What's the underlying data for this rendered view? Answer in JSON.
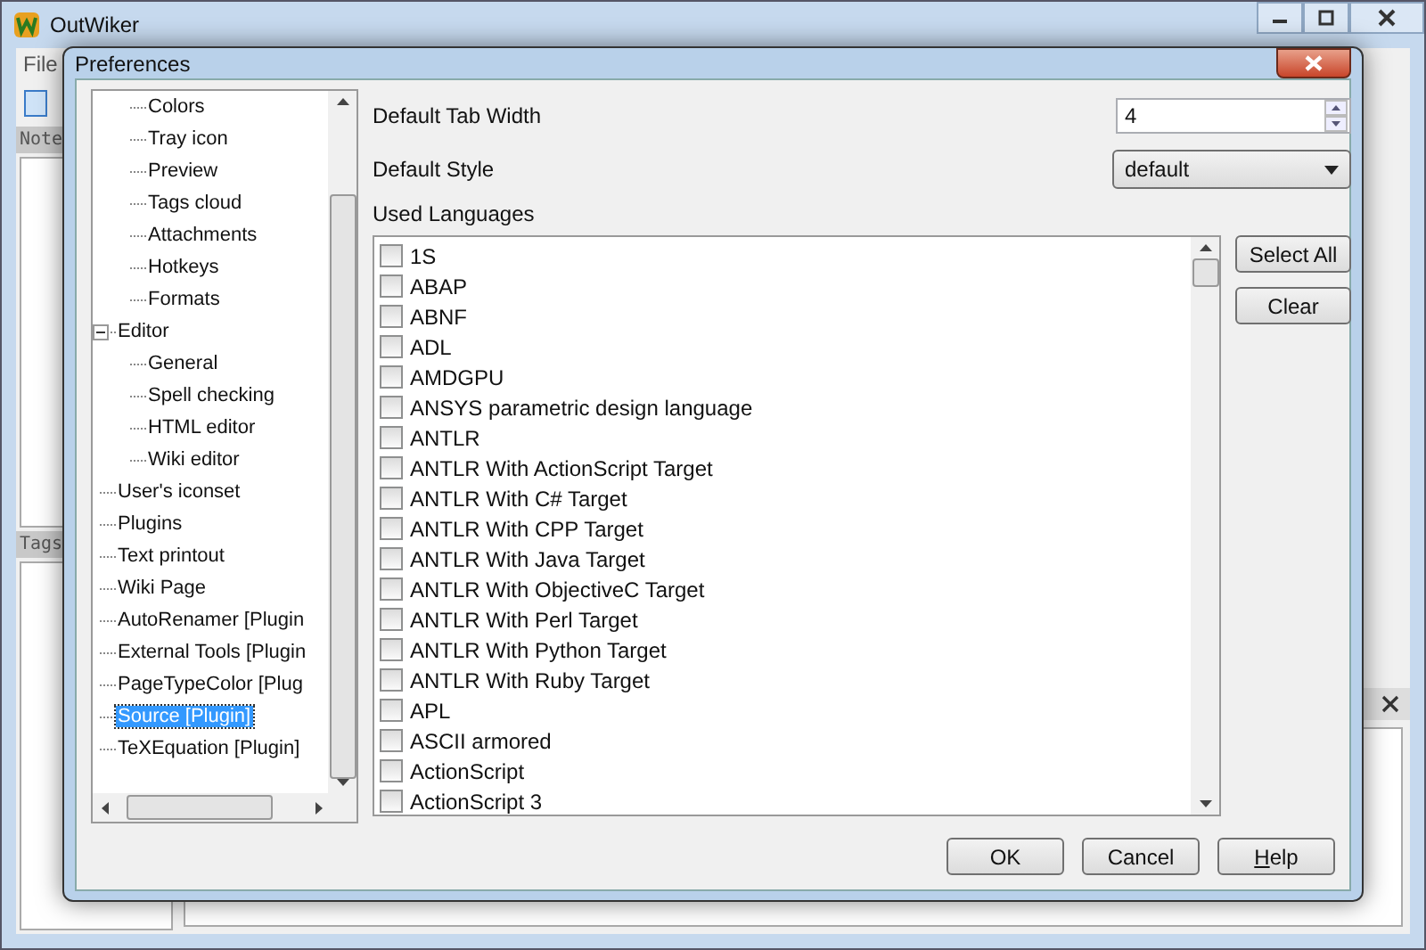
{
  "main_window": {
    "title": "OutWiker",
    "menu": [
      "File"
    ],
    "panels": [
      {
        "label": "Note"
      },
      {
        "label": "Tags"
      }
    ]
  },
  "dialog": {
    "title": "Preferences",
    "tree": {
      "items": [
        {
          "children": [
            {
              "label": "Colors",
              "selected": false
            },
            {
              "label": "Tray icon",
              "selected": false
            },
            {
              "label": "Preview",
              "selected": false
            },
            {
              "label": "Tags cloud",
              "selected": false
            },
            {
              "label": "Attachments",
              "selected": false
            },
            {
              "label": "Hotkeys",
              "selected": false
            },
            {
              "label": "Formats",
              "selected": false
            }
          ]
        },
        {
          "label": "Editor",
          "selected": false,
          "expanded": true,
          "children": [
            {
              "label": "General",
              "selected": false
            },
            {
              "label": "Spell checking",
              "selected": false
            },
            {
              "label": "HTML editor",
              "selected": false
            },
            {
              "label": "Wiki editor",
              "selected": false
            }
          ]
        },
        {
          "label": "User's iconset",
          "selected": false
        },
        {
          "label": "Plugins",
          "selected": false
        },
        {
          "label": "Text printout",
          "selected": false
        },
        {
          "label": "Wiki Page",
          "selected": false
        },
        {
          "label": "AutoRenamer [Plugin",
          "selected": false
        },
        {
          "label": "External Tools [Plugin",
          "selected": false
        },
        {
          "label": "PageTypeColor [Plug",
          "selected": false
        },
        {
          "label": "Source [Plugin]",
          "selected": true
        },
        {
          "label": "TeXEquation [Plugin]",
          "selected": false
        }
      ]
    },
    "tab_width": {
      "label": "Default Tab Width",
      "value": "4"
    },
    "style": {
      "label": "Default Style",
      "value": "default"
    },
    "languages": {
      "label": "Used Languages",
      "items": [
        {
          "label": "1S",
          "checked": false
        },
        {
          "label": "ABAP",
          "checked": false
        },
        {
          "label": "ABNF",
          "checked": false
        },
        {
          "label": "ADL",
          "checked": false
        },
        {
          "label": "AMDGPU",
          "checked": false
        },
        {
          "label": "ANSYS parametric design language",
          "checked": false
        },
        {
          "label": "ANTLR",
          "checked": false
        },
        {
          "label": "ANTLR With ActionScript Target",
          "checked": false
        },
        {
          "label": "ANTLR With C# Target",
          "checked": false
        },
        {
          "label": "ANTLR With CPP Target",
          "checked": false
        },
        {
          "label": "ANTLR With Java Target",
          "checked": false
        },
        {
          "label": "ANTLR With ObjectiveC Target",
          "checked": false
        },
        {
          "label": "ANTLR With Perl Target",
          "checked": false
        },
        {
          "label": "ANTLR With Python Target",
          "checked": false
        },
        {
          "label": "ANTLR With Ruby Target",
          "checked": false
        },
        {
          "label": "APL",
          "checked": false
        },
        {
          "label": "ASCII armored",
          "checked": false
        },
        {
          "label": "ActionScript",
          "checked": false
        },
        {
          "label": "ActionScript 3",
          "checked": false
        }
      ],
      "buttons": [
        "Select All",
        "Clear"
      ]
    },
    "buttons": [
      "OK",
      "Cancel",
      "Help"
    ]
  }
}
